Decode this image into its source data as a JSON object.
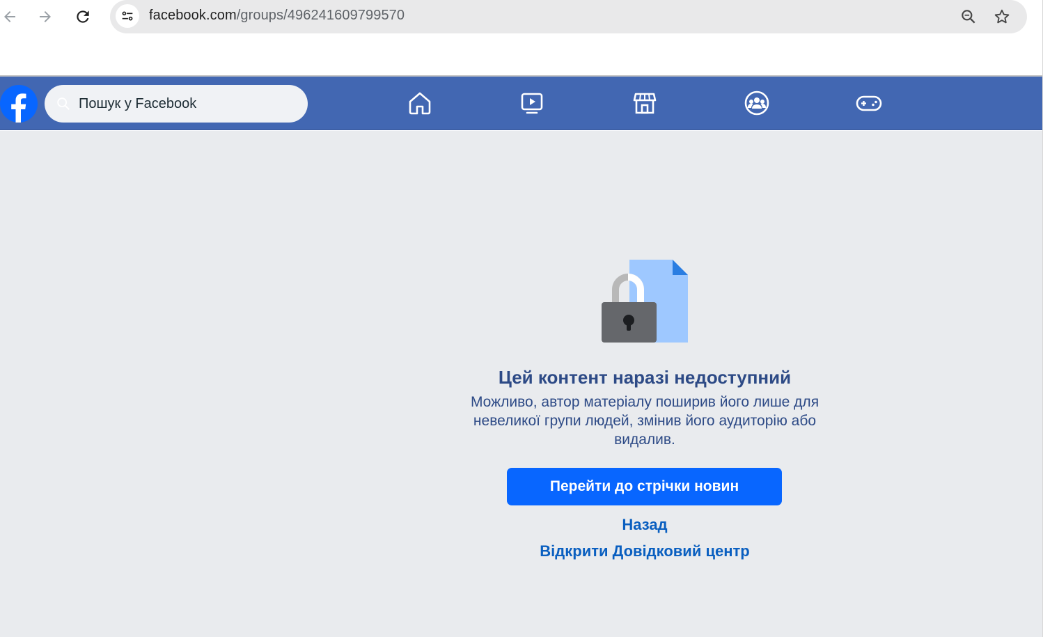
{
  "browser": {
    "url_domain": "facebook.com",
    "url_path": "/groups/496241609799570"
  },
  "header": {
    "search_placeholder": "Пошук у Facebook",
    "brand_color": "#4267b2",
    "nav_icons": [
      "home-icon",
      "video-icon",
      "marketplace-icon",
      "groups-icon",
      "gaming-icon"
    ]
  },
  "main": {
    "title": "Цей контент наразі недоступний",
    "description": "Можливо, автор матеріалу поширив його лише для невеликої групи людей, змінив його аудиторію або видалив.",
    "primary_button": "Перейти до стрічки новин",
    "back_link": "Назад",
    "help_link": "Відкрити Довідковий центр",
    "accent_color": "#0866ff"
  }
}
